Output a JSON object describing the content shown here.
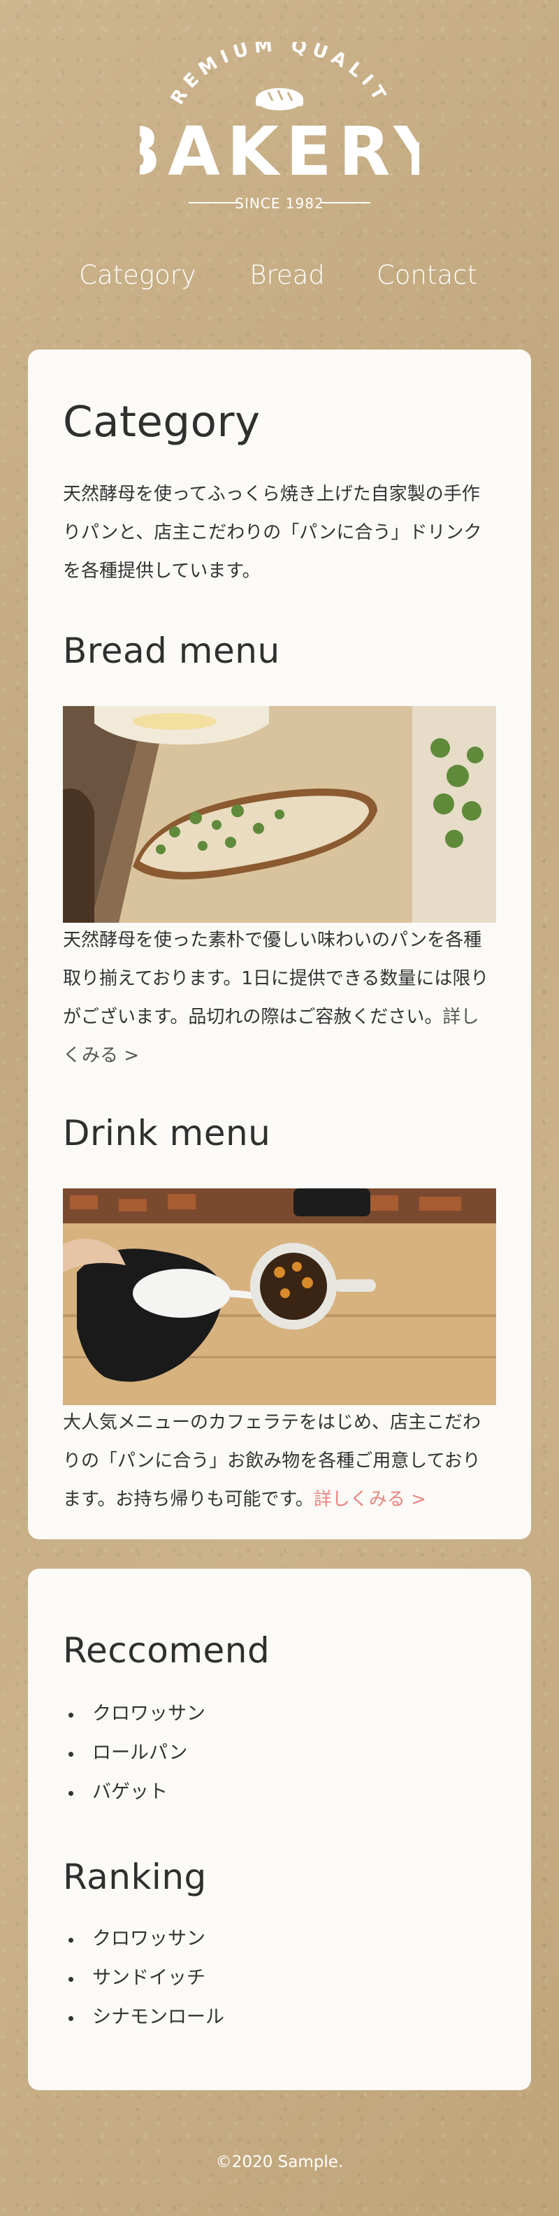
{
  "header": {
    "logo_top": "PREMIUM QUALITY",
    "logo_main": "BAKERY",
    "logo_since": "SINCE 1982",
    "nav": [
      {
        "label": "Category"
      },
      {
        "label": "Bread"
      },
      {
        "label": "Contact"
      }
    ]
  },
  "category": {
    "title": "Category",
    "intro": "天然酵母を使ってふっくら焼き上げた自家製の手作りパンと、店主こだわりの「パンに合う」ドリンクを各種提供しています。",
    "bread": {
      "title": "Bread menu",
      "image_label": "bread-photo",
      "text": "天然酵母を使った素朴で優しい味わいのパンを各種取り揃えております。1日に提供できる数量には限りがございます。品切れの際はご容赦ください。",
      "more": "詳しくみる >"
    },
    "drink": {
      "title": "Drink menu",
      "image_label": "drink-photo",
      "text": "大人気メニューのカフェラテをはじめ、店主こだわりの「パンに合う」お飲み物を各種ご用意しております。お持ち帰りも可能です。",
      "more": "詳しくみる >"
    }
  },
  "sidebar": {
    "recommend_title": "Reccomend",
    "recommend": [
      "クロワッサン",
      "ロールパン",
      "バゲット"
    ],
    "ranking_title": "Ranking",
    "ranking": [
      "クロワッサン",
      "サンドイッチ",
      "シナモンロール"
    ]
  },
  "footer": {
    "copyright": "©2020 Sample."
  },
  "colors": {
    "background": "#c8b089",
    "card": "#fbfaf7",
    "link_accent": "#e98580"
  }
}
